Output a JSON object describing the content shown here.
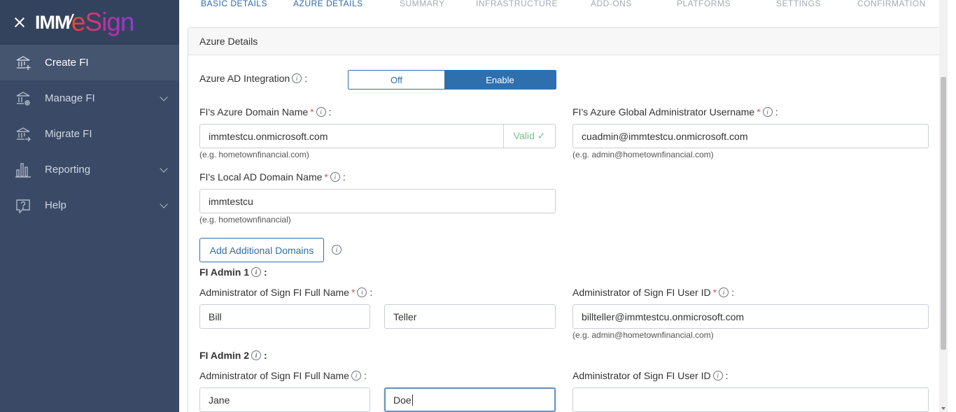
{
  "sidebar": {
    "logo_left": "IMM",
    "logo_slash": "/",
    "logo_right": "eSign",
    "items": [
      {
        "label": "Create FI"
      },
      {
        "label": "Manage FI"
      },
      {
        "label": "Migrate FI"
      },
      {
        "label": "Reporting"
      },
      {
        "label": "Help"
      }
    ]
  },
  "steps": [
    {
      "label": "BASIC DETAILS",
      "state": "done"
    },
    {
      "label": "AZURE DETAILS",
      "state": "current"
    },
    {
      "label": "SUMMARY",
      "state": "pending"
    },
    {
      "label": "INFRASTRUCTURE",
      "state": "pending"
    },
    {
      "label": "ADD-ONS",
      "state": "pending"
    },
    {
      "label": "PLATFORMS",
      "state": "pending"
    },
    {
      "label": "SETTINGS",
      "state": "pending"
    },
    {
      "label": "CONFIRMATION",
      "state": "pending"
    }
  ],
  "card": {
    "title": "Azure Details",
    "ad_integration": {
      "label": "Azure AD Integration",
      "off_label": "Off",
      "on_label": "Enable",
      "selected": "Enable"
    },
    "azure_domain": {
      "label": "FI's Azure Domain Name",
      "required": "*",
      "value": "immtestcu.onmicrosoft.com",
      "valid_label": "Valid ✓",
      "hint": "(e.g. hometownfinancial.com)"
    },
    "global_admin": {
      "label": "FI's Azure Global Administrator Username",
      "required": "*",
      "value": "cuadmin@immtestcu.onmicrosoft.com",
      "hint": "(e.g. admin@hometownfinancial.com)"
    },
    "local_domain": {
      "label": "FI's Local AD Domain Name",
      "required": "*",
      "value": "immtestcu",
      "hint": "(e.g. hometownfinancial)"
    },
    "add_domains_button": "Add Additional Domains",
    "admin1": {
      "heading": "FI Admin 1",
      "fullname_label": "Administrator of Sign FI Full Name",
      "required": "*",
      "first": "Bill",
      "last": "Teller",
      "userid_label": "Administrator of Sign FI User ID",
      "userid": "billteller@immtestcu.onmicrosoft.com",
      "userid_hint": "(e.g. admin@hometownfinancial.com)"
    },
    "admin2": {
      "heading": "FI Admin 2",
      "fullname_label": "Administrator of Sign FI Full Name",
      "first": "Jane",
      "last": "Doe",
      "userid_label": "Administrator of Sign FI User ID",
      "userid": ""
    }
  },
  "colors": {
    "sidebar_bg": "#3a4a66",
    "accent": "#2e6fae",
    "valid": "#7ac08b",
    "required": "#d9534f"
  }
}
